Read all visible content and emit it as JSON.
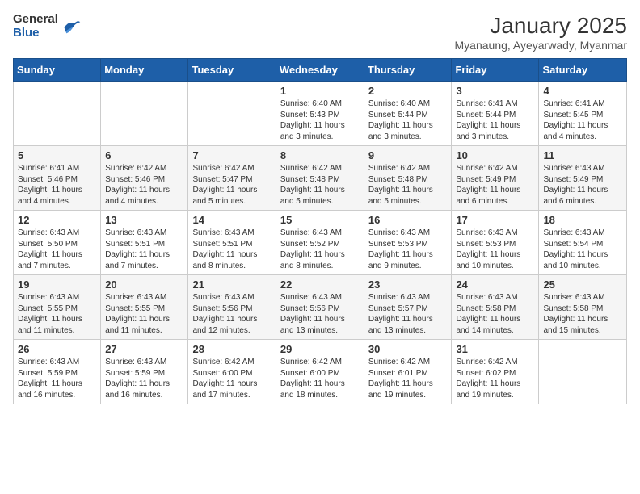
{
  "logo": {
    "general": "General",
    "blue": "Blue"
  },
  "title": "January 2025",
  "subtitle": "Myanaung, Ayeyarwady, Myanmar",
  "days": [
    "Sunday",
    "Monday",
    "Tuesday",
    "Wednesday",
    "Thursday",
    "Friday",
    "Saturday"
  ],
  "weeks": [
    [
      {
        "day": "",
        "content": ""
      },
      {
        "day": "",
        "content": ""
      },
      {
        "day": "",
        "content": ""
      },
      {
        "day": "1",
        "content": "Sunrise: 6:40 AM\nSunset: 5:43 PM\nDaylight: 11 hours and 3 minutes."
      },
      {
        "day": "2",
        "content": "Sunrise: 6:40 AM\nSunset: 5:44 PM\nDaylight: 11 hours and 3 minutes."
      },
      {
        "day": "3",
        "content": "Sunrise: 6:41 AM\nSunset: 5:44 PM\nDaylight: 11 hours and 3 minutes."
      },
      {
        "day": "4",
        "content": "Sunrise: 6:41 AM\nSunset: 5:45 PM\nDaylight: 11 hours and 4 minutes."
      }
    ],
    [
      {
        "day": "5",
        "content": "Sunrise: 6:41 AM\nSunset: 5:46 PM\nDaylight: 11 hours and 4 minutes."
      },
      {
        "day": "6",
        "content": "Sunrise: 6:42 AM\nSunset: 5:46 PM\nDaylight: 11 hours and 4 minutes."
      },
      {
        "day": "7",
        "content": "Sunrise: 6:42 AM\nSunset: 5:47 PM\nDaylight: 11 hours and 5 minutes."
      },
      {
        "day": "8",
        "content": "Sunrise: 6:42 AM\nSunset: 5:48 PM\nDaylight: 11 hours and 5 minutes."
      },
      {
        "day": "9",
        "content": "Sunrise: 6:42 AM\nSunset: 5:48 PM\nDaylight: 11 hours and 5 minutes."
      },
      {
        "day": "10",
        "content": "Sunrise: 6:42 AM\nSunset: 5:49 PM\nDaylight: 11 hours and 6 minutes."
      },
      {
        "day": "11",
        "content": "Sunrise: 6:43 AM\nSunset: 5:49 PM\nDaylight: 11 hours and 6 minutes."
      }
    ],
    [
      {
        "day": "12",
        "content": "Sunrise: 6:43 AM\nSunset: 5:50 PM\nDaylight: 11 hours and 7 minutes."
      },
      {
        "day": "13",
        "content": "Sunrise: 6:43 AM\nSunset: 5:51 PM\nDaylight: 11 hours and 7 minutes."
      },
      {
        "day": "14",
        "content": "Sunrise: 6:43 AM\nSunset: 5:51 PM\nDaylight: 11 hours and 8 minutes."
      },
      {
        "day": "15",
        "content": "Sunrise: 6:43 AM\nSunset: 5:52 PM\nDaylight: 11 hours and 8 minutes."
      },
      {
        "day": "16",
        "content": "Sunrise: 6:43 AM\nSunset: 5:53 PM\nDaylight: 11 hours and 9 minutes."
      },
      {
        "day": "17",
        "content": "Sunrise: 6:43 AM\nSunset: 5:53 PM\nDaylight: 11 hours and 10 minutes."
      },
      {
        "day": "18",
        "content": "Sunrise: 6:43 AM\nSunset: 5:54 PM\nDaylight: 11 hours and 10 minutes."
      }
    ],
    [
      {
        "day": "19",
        "content": "Sunrise: 6:43 AM\nSunset: 5:55 PM\nDaylight: 11 hours and 11 minutes."
      },
      {
        "day": "20",
        "content": "Sunrise: 6:43 AM\nSunset: 5:55 PM\nDaylight: 11 hours and 11 minutes."
      },
      {
        "day": "21",
        "content": "Sunrise: 6:43 AM\nSunset: 5:56 PM\nDaylight: 11 hours and 12 minutes."
      },
      {
        "day": "22",
        "content": "Sunrise: 6:43 AM\nSunset: 5:56 PM\nDaylight: 11 hours and 13 minutes."
      },
      {
        "day": "23",
        "content": "Sunrise: 6:43 AM\nSunset: 5:57 PM\nDaylight: 11 hours and 13 minutes."
      },
      {
        "day": "24",
        "content": "Sunrise: 6:43 AM\nSunset: 5:58 PM\nDaylight: 11 hours and 14 minutes."
      },
      {
        "day": "25",
        "content": "Sunrise: 6:43 AM\nSunset: 5:58 PM\nDaylight: 11 hours and 15 minutes."
      }
    ],
    [
      {
        "day": "26",
        "content": "Sunrise: 6:43 AM\nSunset: 5:59 PM\nDaylight: 11 hours and 16 minutes."
      },
      {
        "day": "27",
        "content": "Sunrise: 6:43 AM\nSunset: 5:59 PM\nDaylight: 11 hours and 16 minutes."
      },
      {
        "day": "28",
        "content": "Sunrise: 6:42 AM\nSunset: 6:00 PM\nDaylight: 11 hours and 17 minutes."
      },
      {
        "day": "29",
        "content": "Sunrise: 6:42 AM\nSunset: 6:00 PM\nDaylight: 11 hours and 18 minutes."
      },
      {
        "day": "30",
        "content": "Sunrise: 6:42 AM\nSunset: 6:01 PM\nDaylight: 11 hours and 19 minutes."
      },
      {
        "day": "31",
        "content": "Sunrise: 6:42 AM\nSunset: 6:02 PM\nDaylight: 11 hours and 19 minutes."
      },
      {
        "day": "",
        "content": ""
      }
    ]
  ]
}
